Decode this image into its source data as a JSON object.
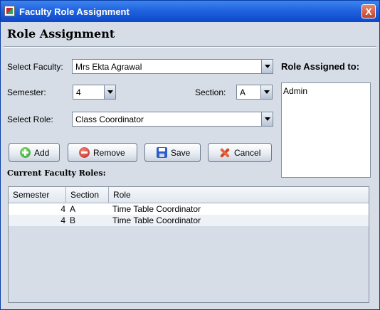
{
  "window": {
    "title": "Faculty Role Assignment",
    "close_label": "X"
  },
  "heading": "Role Assignment",
  "form": {
    "faculty_label": "Select Faculty:",
    "faculty_value": "Mrs Ekta Agrawal",
    "semester_label": "Semester:",
    "semester_value": "4",
    "section_label": "Section:",
    "section_value": "A",
    "role_label": "Select Role:",
    "role_value": "Class Coordinator"
  },
  "assigned": {
    "label": "Role Assigned to:",
    "items": [
      "Admin"
    ]
  },
  "buttons": {
    "add": "Add",
    "remove": "Remove",
    "save": "Save",
    "cancel": "Cancel"
  },
  "current_roles": {
    "title": "Current Faculty Roles:",
    "columns": [
      "Semester",
      "Section",
      "Role"
    ],
    "rows": [
      {
        "semester": "4",
        "section": "A",
        "role": "Time Table Coordinator"
      },
      {
        "semester": "4",
        "section": "B",
        "role": "Time Table Coordinator"
      }
    ]
  }
}
